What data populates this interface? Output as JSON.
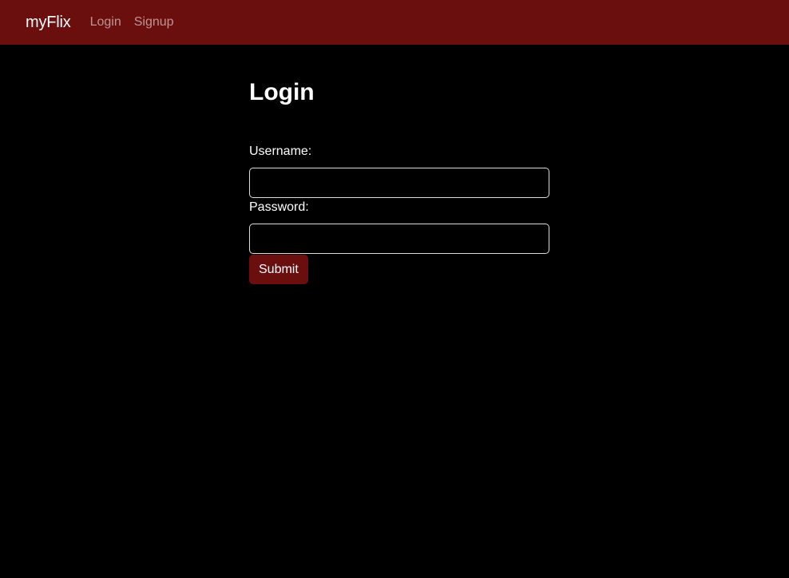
{
  "navbar": {
    "brand": "myFlix",
    "links": [
      "Login",
      "Signup"
    ],
    "background_color": "#6b0e0e"
  },
  "login_form": {
    "title": "Login",
    "username_label": "Username:",
    "username_value": "",
    "password_label": "Password:",
    "password_value": "",
    "submit_label": "Submit",
    "submit_color": "#6b0e0e"
  },
  "colors": {
    "page_background": "#000000",
    "text": "#ffffff",
    "nav_link": "#a8a8a8",
    "input_border": "#dddddd"
  }
}
